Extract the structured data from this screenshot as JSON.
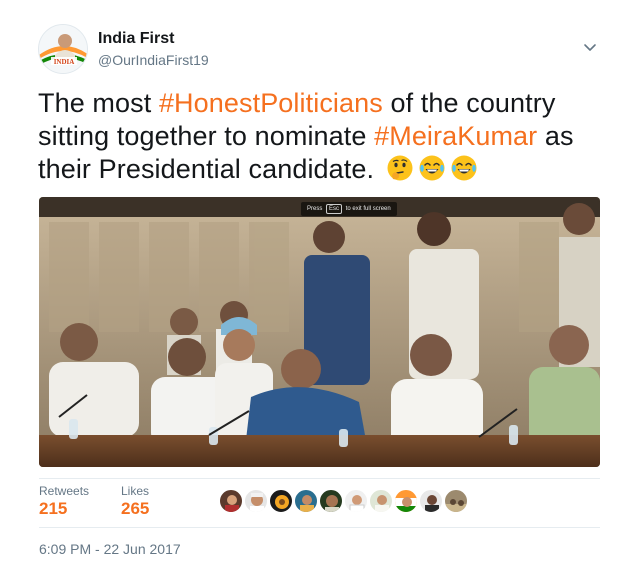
{
  "author": {
    "name": "India First",
    "handle": "@OurIndiaFirst19",
    "avatar_text": "INDIA"
  },
  "tweet": {
    "segments": [
      {
        "text": "The most ",
        "type": "text"
      },
      {
        "text": "#HonestPoliticians",
        "type": "hashtag"
      },
      {
        "text": " of the country sitting together to nominate ",
        "type": "text"
      },
      {
        "text": "#MeiraKumar",
        "type": "hashtag"
      },
      {
        "text": " as their Presidential candidate. ",
        "type": "text"
      }
    ],
    "emojis": [
      "thinking-face-emoji",
      "face-with-tears-of-joy-emoji",
      "face-with-tears-of-joy-emoji"
    ]
  },
  "media": {
    "overlay_prefix": "Press",
    "overlay_key": "Esc",
    "overlay_suffix": "to exit full screen"
  },
  "stats": {
    "retweets_label": "Retweets",
    "retweets_value": "215",
    "likes_label": "Likes",
    "likes_value": "265"
  },
  "timestamp": "6:09 PM - 22 Jun 2017",
  "colors": {
    "accent": "#f5701f",
    "text": "#14171a",
    "secondary": "#657786",
    "divider": "#e6ecf0"
  }
}
